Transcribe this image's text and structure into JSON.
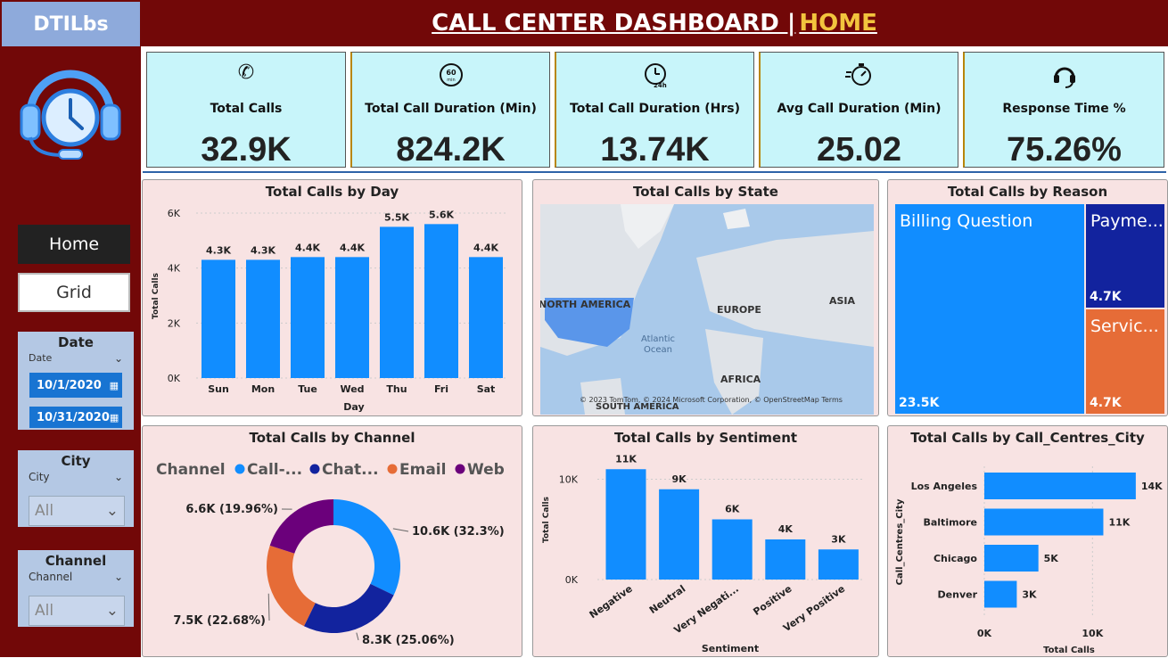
{
  "brand": "DTILbs",
  "header": {
    "title": "CALL CENTER DASHBOARD |",
    "page": "HOME"
  },
  "nav": {
    "home": "Home",
    "grid": "Grid"
  },
  "slicers": {
    "date": {
      "title": "Date",
      "field": "Date",
      "start": "10/1/2020",
      "end": "10/31/2020"
    },
    "city": {
      "title": "City",
      "field": "City",
      "value": "All"
    },
    "channel": {
      "title": "Channel",
      "field": "Channel",
      "value": "All"
    }
  },
  "kpis": [
    {
      "label": "Total Calls",
      "value": "32.9K",
      "icon": "phone-icon"
    },
    {
      "label": "Total Call Duration (Min)",
      "value": "824.2K",
      "icon": "60-min-icon"
    },
    {
      "label": "Total Call Duration (Hrs)",
      "value": "13.74K",
      "icon": "24h-clock-icon"
    },
    {
      "label": "Avg Call Duration (Min)",
      "value": "25.02",
      "icon": "stopwatch-icon"
    },
    {
      "label": "Response Time %",
      "value": "75.26%",
      "icon": "headset-icon"
    }
  ],
  "colors": {
    "bar": "#118dff",
    "dark_blue": "#12239e",
    "orange": "#e66c37",
    "purple": "#6b007b",
    "maroon": "#720808"
  },
  "day_chart": {
    "title": "Total Calls by Day",
    "xlabel": "Day",
    "ylabel": "Total Calls"
  },
  "map": {
    "title": "Total Calls by State",
    "labels": [
      "NORTH AMERICA",
      "EUROPE",
      "ASIA",
      "AFRICA",
      "SOUTH AMERICA",
      "Atlantic Ocean"
    ],
    "credit": "© 2023 TomTom, © 2024 Microsoft Corporation, © OpenStreetMap  Terms"
  },
  "reason": {
    "title": "Total Calls by Reason",
    "items": [
      {
        "name": "Billing Question",
        "value": "23.5K"
      },
      {
        "name": "Payme...",
        "value": "4.7K"
      },
      {
        "name": "Servic...",
        "value": "4.7K"
      }
    ]
  },
  "channel_chart": {
    "title": "Total Calls by Channel",
    "legend_title": "Channel"
  },
  "sentiment_chart": {
    "title": "Total Calls by Sentiment",
    "xlabel": "Sentiment",
    "ylabel": "Total Calls"
  },
  "city_chart": {
    "title": "Total Calls by Call_Centres_City",
    "xlabel": "Total Calls",
    "ylabel": "Call_Centres_City"
  },
  "chart_data": [
    {
      "type": "bar",
      "title": "Total Calls by Day",
      "categories": [
        "Sun",
        "Mon",
        "Tue",
        "Wed",
        "Thu",
        "Fri",
        "Sat"
      ],
      "values": [
        4300,
        4300,
        4400,
        4400,
        5500,
        5600,
        4400
      ],
      "labels": [
        "4.3K",
        "4.3K",
        "4.4K",
        "4.4K",
        "5.5K",
        "5.6K",
        "4.4K"
      ],
      "ylim": [
        0,
        6000
      ],
      "yticks": [
        "0K",
        "2K",
        "4K",
        "6K"
      ],
      "xlabel": "Day",
      "ylabel": "Total Calls"
    },
    {
      "type": "pie",
      "title": "Total Calls by Channel",
      "categories": [
        "Call-...",
        "Chat...",
        "Email",
        "Web"
      ],
      "values": [
        10600,
        8300,
        7500,
        6600
      ],
      "labels": [
        "10.6K (32.3%)",
        "8.3K (25.06%)",
        "7.5K (22.68%)",
        "6.6K (19.96%)"
      ],
      "colors": [
        "#118dff",
        "#12239e",
        "#e66c37",
        "#6b007b"
      ]
    },
    {
      "type": "bar",
      "title": "Total Calls by Sentiment",
      "categories": [
        "Negative",
        "Neutral",
        "Very Negati...",
        "Positive",
        "Very Positive"
      ],
      "values": [
        11000,
        9000,
        6000,
        4000,
        3000
      ],
      "labels": [
        "11K",
        "9K",
        "6K",
        "4K",
        "3K"
      ],
      "ylim": [
        0,
        12000
      ],
      "yticks": [
        "0K",
        "10K"
      ],
      "xlabel": "Sentiment",
      "ylabel": "Total Calls"
    },
    {
      "type": "bar",
      "orientation": "horizontal",
      "title": "Total Calls by Call_Centres_City",
      "categories": [
        "Los Angeles",
        "Baltimore",
        "Chicago",
        "Denver"
      ],
      "values": [
        14000,
        11000,
        5000,
        3000
      ],
      "labels": [
        "14K",
        "11K",
        "5K",
        "3K"
      ],
      "xlim": [
        0,
        15000
      ],
      "xticks": [
        "0K",
        "10K"
      ],
      "xlabel": "Total Calls",
      "ylabel": "Call_Centres_City"
    }
  ]
}
